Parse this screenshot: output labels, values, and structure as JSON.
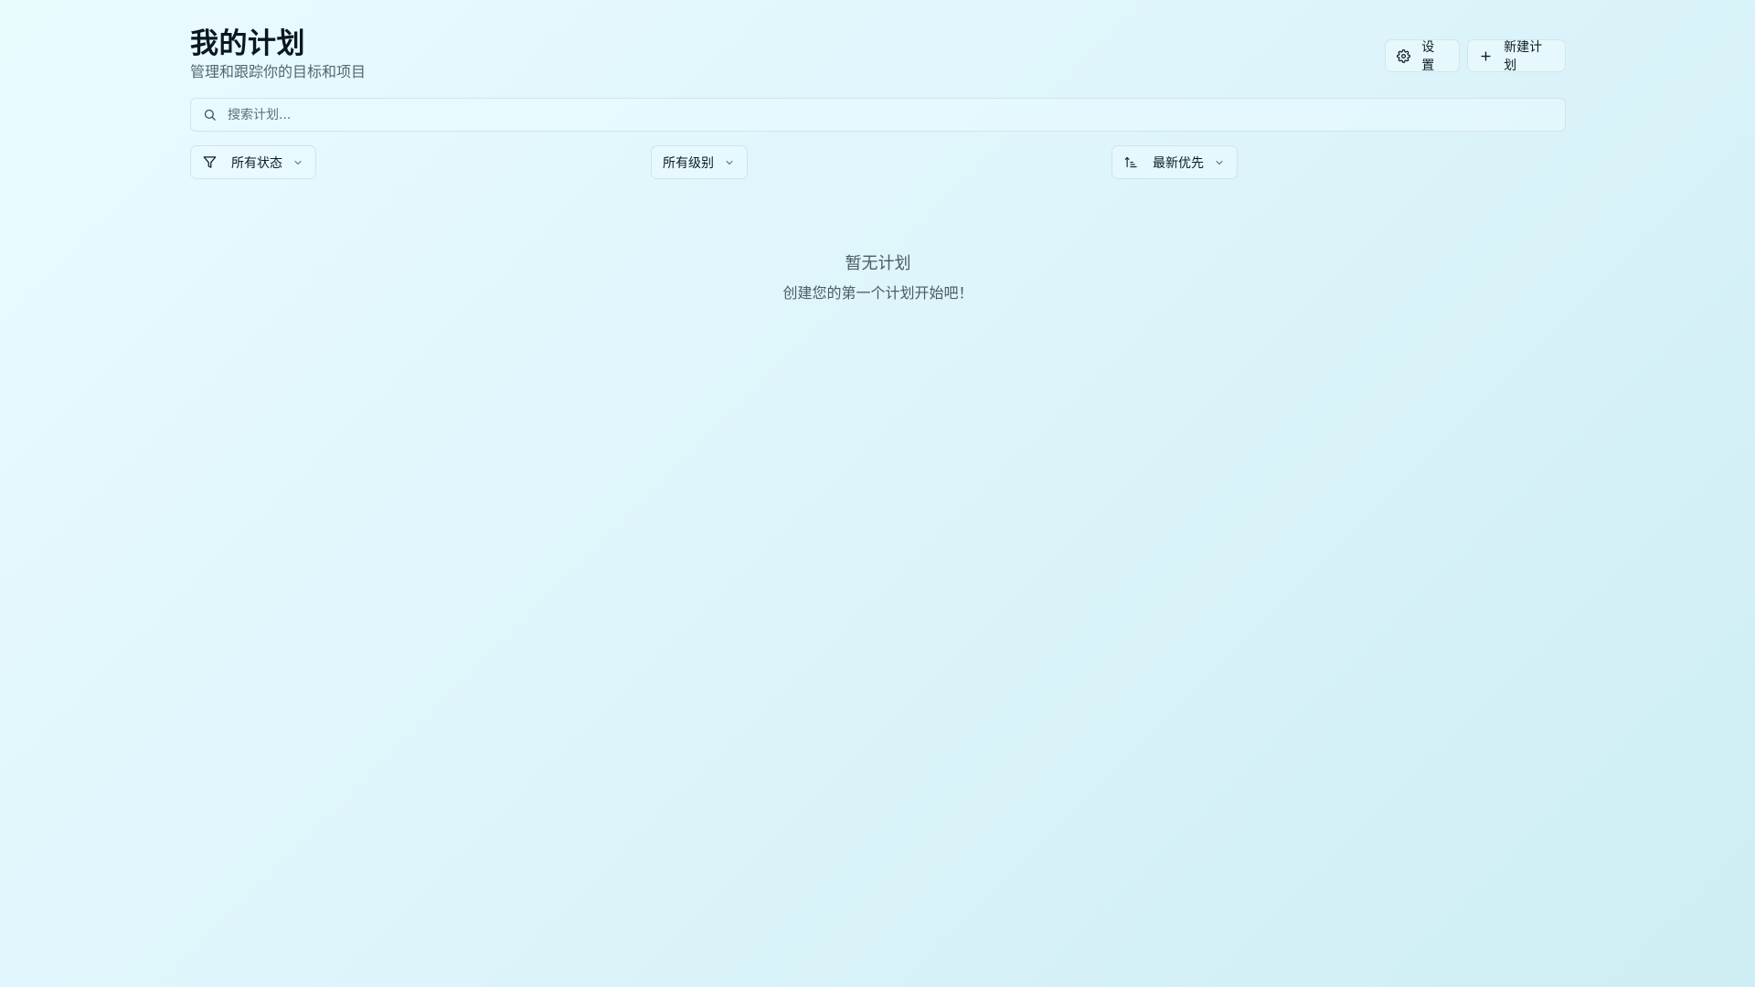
{
  "header": {
    "title": "我的计划",
    "subtitle": "管理和跟踪你的目标和项目",
    "settings_label": "设置",
    "new_plan_label": "新建计划"
  },
  "search": {
    "placeholder": "搜索计划..."
  },
  "filters": {
    "status_selected": "所有状态",
    "level_selected": "所有级别",
    "sort_selected": "最新优先"
  },
  "empty_state": {
    "title": "暂无计划",
    "description": "创建您的第一个计划开始吧！"
  },
  "icons": {
    "settings": "gear-icon",
    "new_plan": "plus-icon",
    "search": "search-icon",
    "status_filter": "filter-icon",
    "sort": "sort-icon",
    "dropdown": "chevron-down-icon"
  },
  "colors": {
    "background_start": "#eafbfe",
    "background_end": "#cdeef4",
    "text_primary": "#0a1620",
    "text_muted": "#53666f",
    "border": "#cfe5eb"
  }
}
